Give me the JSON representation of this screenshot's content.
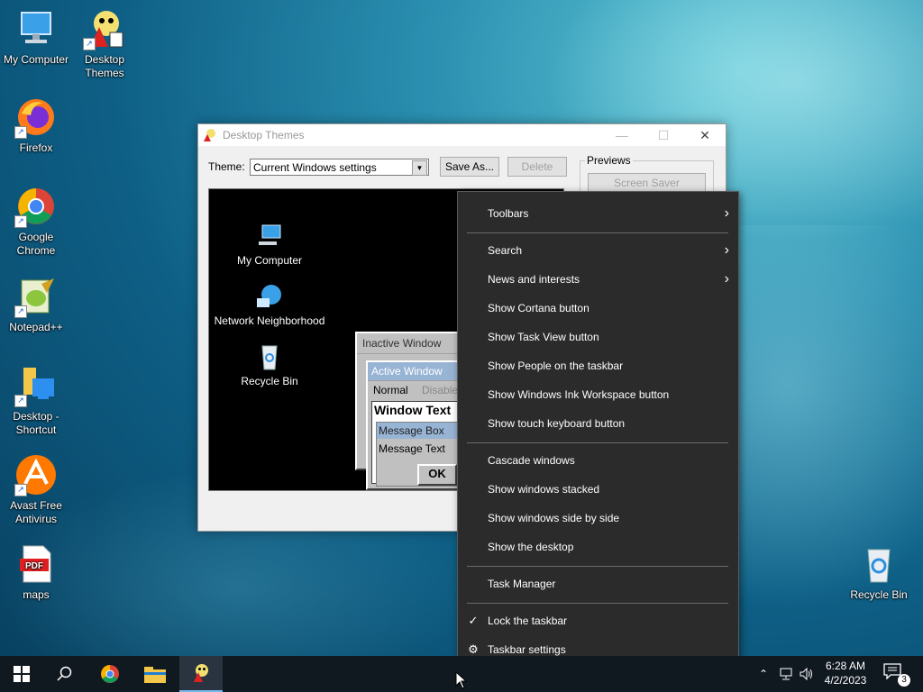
{
  "desktop": {
    "icons": [
      {
        "label": "My Computer"
      },
      {
        "label": "Desktop Themes"
      },
      {
        "label": "Firefox"
      },
      {
        "label": "Google Chrome"
      },
      {
        "label": "Notepad++"
      },
      {
        "label": "Desktop - Shortcut"
      },
      {
        "label": "Avast Free Antivirus"
      },
      {
        "label": "maps"
      },
      {
        "label": "Recycle Bin"
      }
    ]
  },
  "themes_window": {
    "title": "Desktop Themes",
    "theme_label": "Theme:",
    "theme_value": "Current Windows settings",
    "save_as_label": "Save As...",
    "delete_label": "Delete",
    "previews_label": "Previews",
    "screen_saver_label": "Screen Saver",
    "preview": {
      "icons": [
        "My Computer",
        "Network Neighborhood",
        "Recycle Bin"
      ],
      "inactive_window_title": "Inactive Window",
      "active_window_title": "Active Window",
      "menu_normal": "Normal",
      "menu_disabled": "Disabled",
      "window_text": "Window Text",
      "message_box_title": "Message Box",
      "message_text": "Message Text",
      "ok_label": "OK"
    }
  },
  "context_menu": {
    "items": [
      {
        "label": "Toolbars",
        "submenu": true
      },
      {
        "label": "Search",
        "submenu": true
      },
      {
        "label": "News and interests",
        "submenu": true
      },
      {
        "label": "Show Cortana button"
      },
      {
        "label": "Show Task View button"
      },
      {
        "label": "Show People on the taskbar"
      },
      {
        "label": "Show Windows Ink Workspace button"
      },
      {
        "label": "Show touch keyboard button"
      },
      {
        "label": "Cascade windows"
      },
      {
        "label": "Show windows stacked"
      },
      {
        "label": "Show windows side by side"
      },
      {
        "label": "Show the desktop"
      },
      {
        "label": "Task Manager"
      },
      {
        "label": "Lock the taskbar",
        "checked": true
      },
      {
        "label": "Taskbar settings",
        "icon": "gear-icon"
      }
    ]
  },
  "taskbar": {
    "time": "6:28 AM",
    "date": "4/2/2023",
    "notification_count": "3"
  },
  "colors": {
    "menu_bg": "#2b2b2b",
    "taskbar_bg": "#101820",
    "accent": "#76b9ed"
  }
}
